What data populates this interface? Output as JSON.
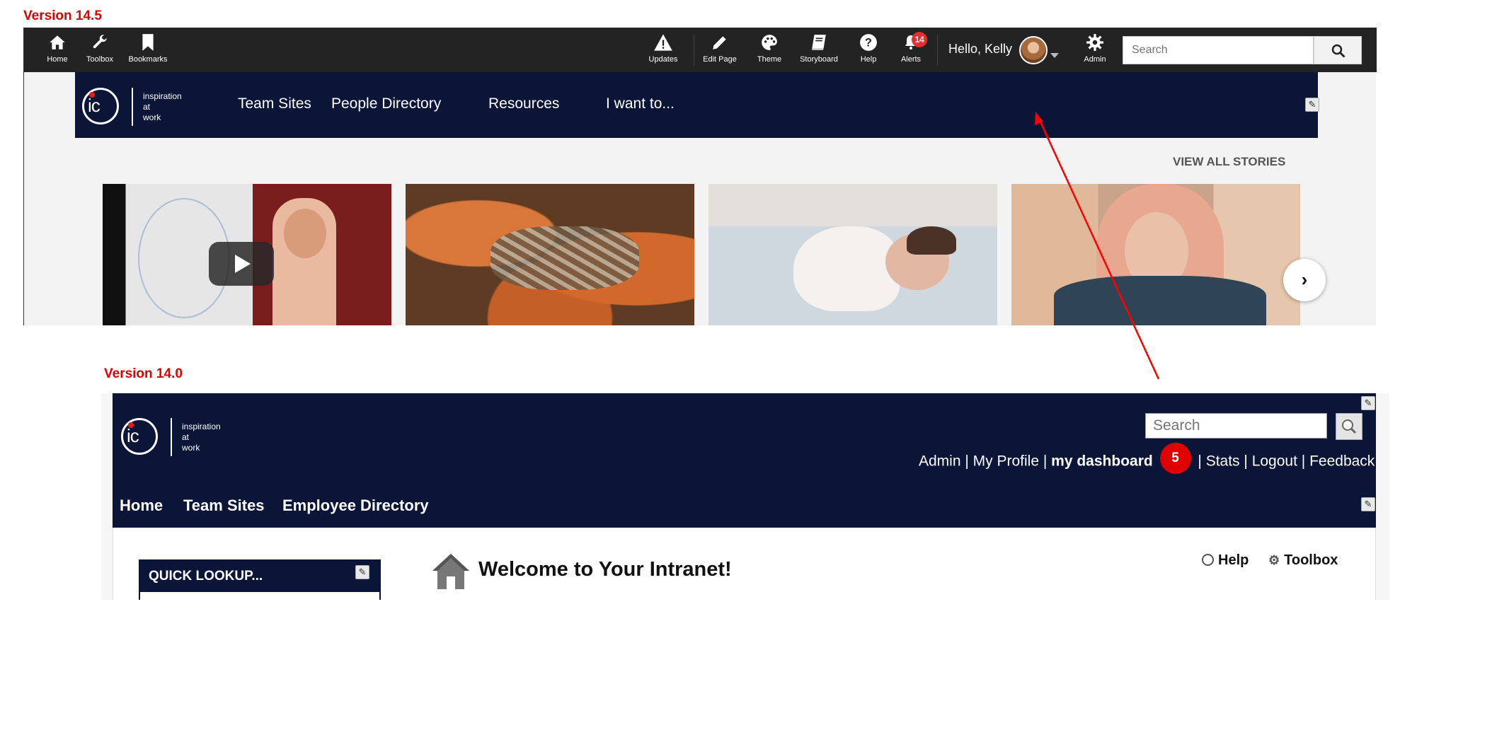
{
  "labels": {
    "v145": "Version 14.5",
    "v140": "Version 14.0"
  },
  "v145": {
    "toolbar_left": [
      {
        "label": "Home",
        "icon": "home-icon"
      },
      {
        "label": "Toolbox",
        "icon": "wrench-icon"
      },
      {
        "label": "Bookmarks",
        "icon": "bookmark-icon"
      }
    ],
    "toolbar_right": [
      {
        "label": "Updates",
        "icon": "warning-icon"
      },
      {
        "label": "Edit Page",
        "icon": "pencil-icon"
      },
      {
        "label": "Theme",
        "icon": "palette-icon"
      },
      {
        "label": "Storyboard",
        "icon": "book-icon"
      },
      {
        "label": "Help",
        "icon": "help-icon"
      },
      {
        "label": "Alerts",
        "icon": "bell-icon",
        "badge": "14"
      }
    ],
    "greeting": "Hello, Kelly",
    "admin_label": "Admin",
    "search_placeholder": "Search",
    "logo": {
      "mark": "ic",
      "tag_lines": [
        "inspiration",
        "at",
        "work"
      ]
    },
    "nav": [
      "Team Sites",
      "People Directory",
      "Resources",
      "I want to..."
    ],
    "view_all": "VIEW ALL STORIES"
  },
  "v140": {
    "search_placeholder": "Search",
    "logo": {
      "mark": "ic",
      "tag_lines": [
        "inspiration",
        "at",
        "work"
      ]
    },
    "top_links": {
      "admin": "Admin",
      "profile": "My Profile",
      "dashboard": "my dashboard",
      "badge": "5",
      "stats": "Stats",
      "logout": "Logout",
      "feedback": "Feedback"
    },
    "nav": [
      "Home",
      "Team Sites",
      "Employee Directory"
    ],
    "quick_lookup": "QUICK LOOKUP...",
    "welcome": "Welcome to Your Intranet!",
    "help": "Help",
    "toolbox": "Toolbox"
  },
  "colors": {
    "accent_red": "#e00000",
    "navy": "#0a1538",
    "toolbar": "#232323"
  }
}
